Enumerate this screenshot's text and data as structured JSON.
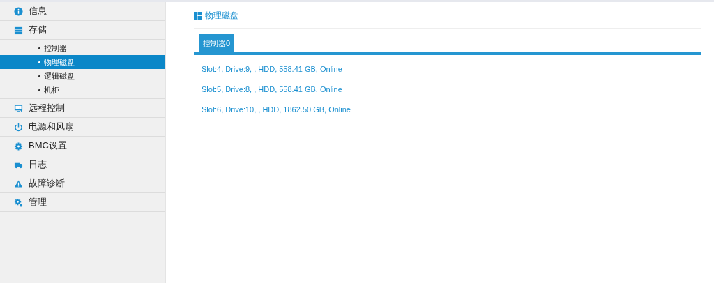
{
  "sidebar": {
    "items": [
      {
        "label": "信息",
        "selected": false
      },
      {
        "label": "存储",
        "selected": false,
        "children": [
          {
            "label": "控制器",
            "selected": false
          },
          {
            "label": "物理磁盘",
            "selected": true
          },
          {
            "label": "逻辑磁盘",
            "selected": false
          },
          {
            "label": "机柜",
            "selected": false
          }
        ]
      },
      {
        "label": "远程控制",
        "selected": false
      },
      {
        "label": "电源和风扇",
        "selected": false
      },
      {
        "label": "BMC设置",
        "selected": false
      },
      {
        "label": "日志",
        "selected": false
      },
      {
        "label": "故障诊断",
        "selected": false
      },
      {
        "label": "管理",
        "selected": false
      }
    ]
  },
  "page": {
    "title": "物理磁盘",
    "tabs": [
      {
        "label": "控制器0",
        "selected": true
      }
    ],
    "disks": [
      {
        "text": "Slot:4, Drive:9, , HDD, 558.41 GB, Online"
      },
      {
        "text": "Slot:5, Drive:8, , HDD, 558.41 GB, Online"
      },
      {
        "text": "Slot:6, Drive:10, , HDD, 1862.50 GB, Online"
      }
    ]
  }
}
